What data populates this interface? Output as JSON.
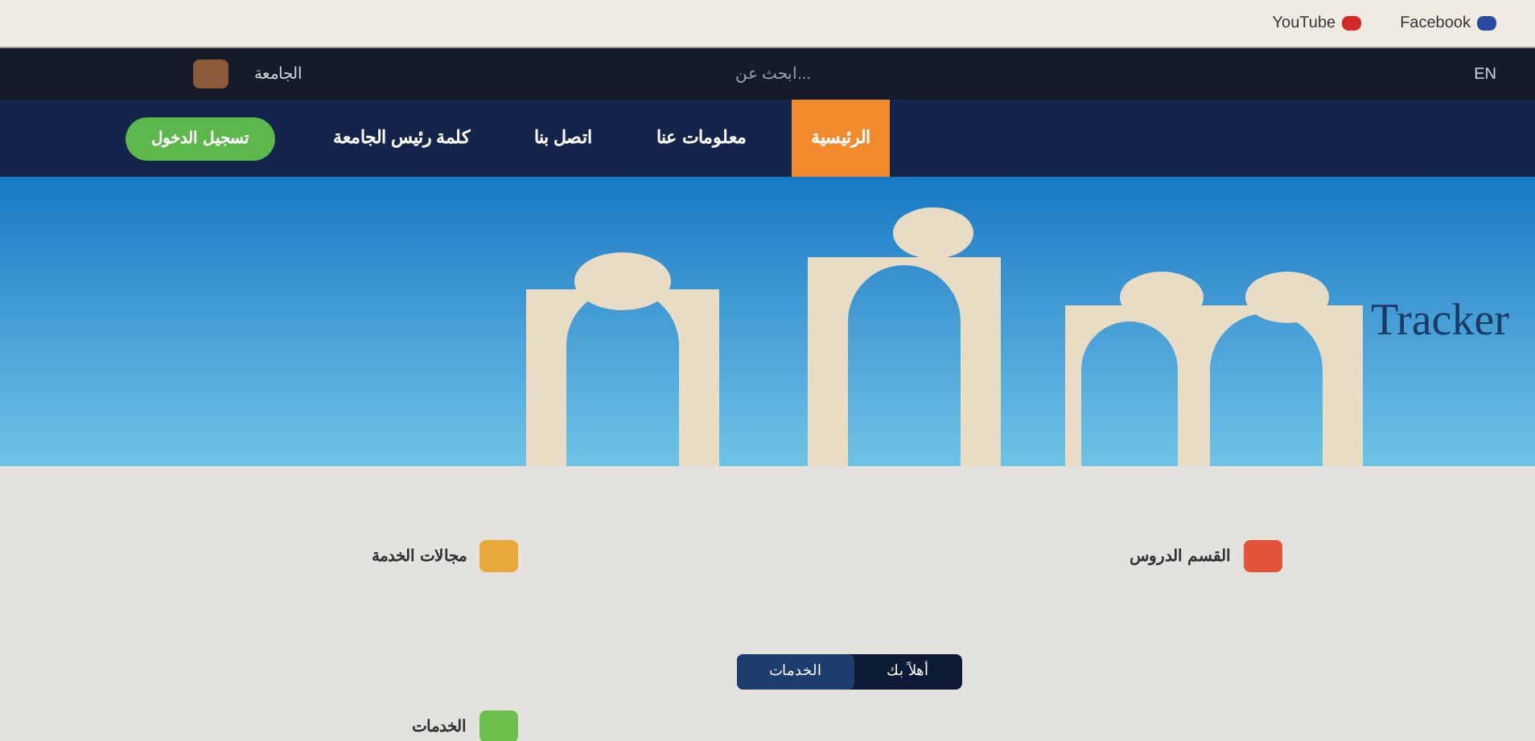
{
  "bookmarks": [
    {
      "label": "Facebook",
      "color": "#2a4aa0"
    },
    {
      "label": "YouTube",
      "color": "#d12a2a"
    }
  ],
  "top_bar": {
    "site_name": "الجامعة",
    "search": {
      "placeholder": "ابحث عن..."
    },
    "language": "EN"
  },
  "nav": {
    "login_button": "تسجيل الدخول",
    "items": [
      {
        "label": "الرئيسية",
        "selected": true
      },
      {
        "label": "معلومات عنا",
        "selected": false
      },
      {
        "label": "اتصل بنا",
        "selected": false
      },
      {
        "label": "كلمة رئيس الجامعة",
        "selected": false
      }
    ]
  },
  "hero": {
    "title": "Tracker"
  },
  "cards": [
    {
      "title": "مجالات الخدمة",
      "color": "#e8a93a"
    },
    {
      "title": "القسم الدروس",
      "color": "#e2533a"
    },
    {
      "title": "الخدمات",
      "color": "#6cbf4a"
    }
  ],
  "toggle": [
    {
      "label": "أهلاً بك",
      "selected": false
    },
    {
      "label": "الخدمات",
      "selected": true
    }
  ]
}
